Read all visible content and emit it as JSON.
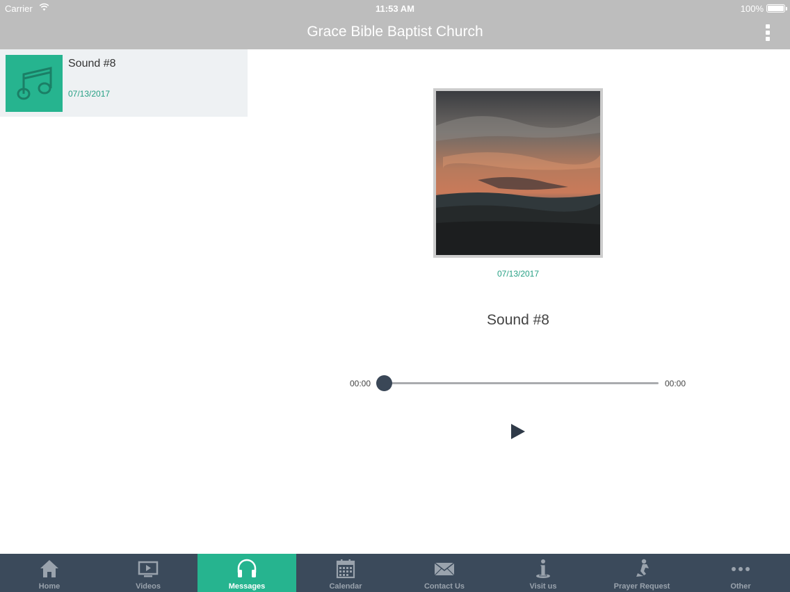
{
  "status_bar": {
    "carrier": "Carrier",
    "time": "11:53 AM",
    "battery": "100%"
  },
  "header": {
    "title": "Grace Bible Baptist Church",
    "menu_icon": "more-vertical-icon"
  },
  "list": {
    "items": [
      {
        "title": "Sound #8",
        "date": "07/13/2017",
        "icon": "music-note-icon"
      }
    ]
  },
  "detail": {
    "date": "07/13/2017",
    "title": "Sound #8",
    "player": {
      "current_time": "00:00",
      "total_time": "00:00",
      "progress": 0,
      "play_icon": "play-icon"
    }
  },
  "tabs": [
    {
      "label": "Home",
      "icon": "home-icon"
    },
    {
      "label": "Videos",
      "icon": "tv-icon"
    },
    {
      "label": "Messages",
      "icon": "headphones-icon",
      "active": true
    },
    {
      "label": "Calendar",
      "icon": "calendar-icon"
    },
    {
      "label": "Contact Us",
      "icon": "envelope-icon"
    },
    {
      "label": "Visit us",
      "icon": "info-icon"
    },
    {
      "label": "Prayer Request",
      "icon": "prayer-icon"
    },
    {
      "label": "Other",
      "icon": "more-horizontal-icon"
    }
  ],
  "colors": {
    "accent": "#26b48f",
    "header": "#bdbdbd",
    "tabbar": "#3b4a5b",
    "date_text": "#26a084"
  }
}
